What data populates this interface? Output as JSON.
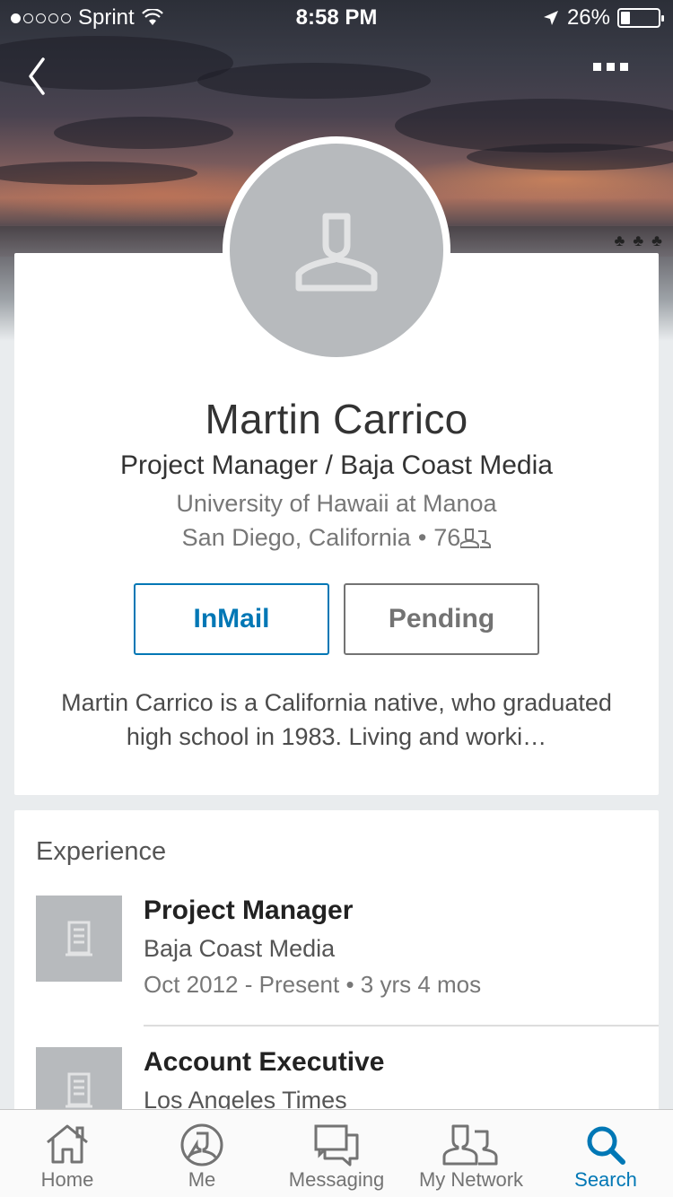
{
  "status_bar": {
    "carrier": "Sprint",
    "time": "8:58 PM",
    "battery": "26%",
    "battery_level": 0.26,
    "signal_bars": 1
  },
  "nav": {
    "back_icon": "chevron-left-icon",
    "more_icon": "more-dots-icon"
  },
  "profile": {
    "name": "Martin Carrico",
    "headline": "Project Manager / Baja Coast Media",
    "school": "University of Hawaii at Manoa",
    "location": "San Diego, California",
    "separator": "•",
    "connections": "76",
    "inmail_label": "InMail",
    "pending_label": "Pending",
    "summary": "Martin Carrico is a California native, who graduated high school in 1983. Living and worki…"
  },
  "experience": {
    "title": "Experience",
    "items": [
      {
        "role": "Project Manager",
        "company": "Baja Coast Media",
        "dates": "Oct 2012 - Present • 3 yrs 4 mos"
      },
      {
        "role": "Account Executive",
        "company": "Los Angeles Times"
      }
    ]
  },
  "tabbar": {
    "tabs": [
      {
        "label": "Home",
        "icon": "home-icon"
      },
      {
        "label": "Me",
        "icon": "profile-icon"
      },
      {
        "label": "Messaging",
        "icon": "messaging-icon"
      },
      {
        "label": "My Network",
        "icon": "network-icon"
      },
      {
        "label": "Search",
        "icon": "search-icon",
        "active": true
      }
    ]
  },
  "colors": {
    "accent": "#0077b5",
    "muted": "#737373",
    "background": "#e9ecee"
  }
}
